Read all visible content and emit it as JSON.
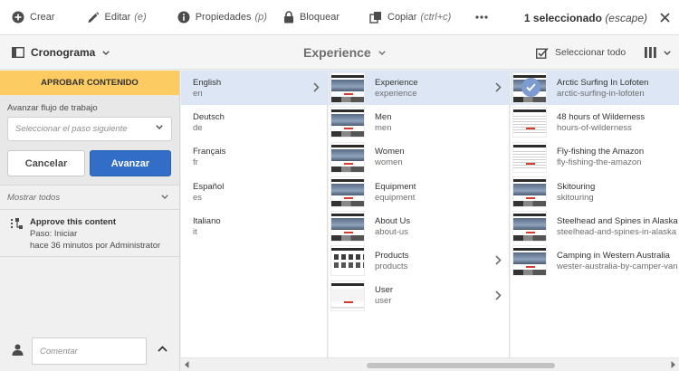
{
  "toolbar": {
    "create": "Crear",
    "edit": "Editar",
    "edit_key": "(e)",
    "properties": "Propiedades",
    "properties_key": "(p)",
    "lock": "Bloquear",
    "copy": "Copiar",
    "copy_key": "(ctrl+c)",
    "selection": "1 seleccionado",
    "selection_escape": "(escape)"
  },
  "subbar": {
    "rail_label": "Cronograma",
    "title": "Experience",
    "select_all": "Seleccionar todo"
  },
  "workflow": {
    "header": "APROBAR CONTENIDO",
    "step_label": "Avanzar flujo de trabajo",
    "step_placeholder": "Seleccionar el paso siguiente",
    "cancel": "Cancelar",
    "advance": "Avanzar",
    "show_all": "Mostrar todos"
  },
  "event": {
    "title": "Approve this content",
    "step": "Paso: Iniciar",
    "meta": "hace 36 minutos por Administrator"
  },
  "comment": {
    "placeholder": "Comentar"
  },
  "columns": {
    "languages": [
      {
        "title": "English",
        "name": "en"
      },
      {
        "title": "Deutsch",
        "name": "de"
      },
      {
        "title": "Français",
        "name": "fr"
      },
      {
        "title": "Español",
        "name": "es"
      },
      {
        "title": "Italiano",
        "name": "it"
      }
    ],
    "sections": [
      {
        "title": "Experience",
        "name": "experience"
      },
      {
        "title": "Men",
        "name": "men"
      },
      {
        "title": "Women",
        "name": "women"
      },
      {
        "title": "Equipment",
        "name": "equipment"
      },
      {
        "title": "About Us",
        "name": "about-us"
      },
      {
        "title": "Products",
        "name": "products"
      },
      {
        "title": "User",
        "name": "user"
      }
    ],
    "pages": [
      {
        "title": "Arctic Surfing In Lofoten",
        "name": "arctic-surfing-in-lofoten"
      },
      {
        "title": "48 hours of Wilderness",
        "name": "hours-of-wilderness"
      },
      {
        "title": "Fly-fishing the Amazon",
        "name": "fly-fishing-the-amazon"
      },
      {
        "title": "Skitouring",
        "name": "skitouring"
      },
      {
        "title": "Steelhead and Spines in Alaska",
        "name": "steelhead-and-spines-in-alaska"
      },
      {
        "title": "Camping in Western Australia",
        "name": "wester-australia-by-camper-van"
      }
    ]
  },
  "colors": {
    "accent": "#326ec8",
    "workflow_header": "#fccc62",
    "selected_row": "#dce6f5"
  }
}
